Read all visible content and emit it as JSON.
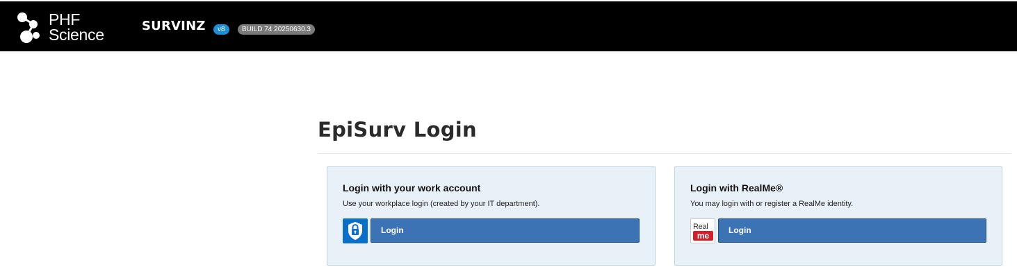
{
  "header": {
    "org_line1": "PHF",
    "org_line2": "Science",
    "logo_icon": "phf-molecule-logo-icon",
    "app_name": "SURVINZ",
    "version": "v8",
    "build": "BUILD 74 20250630.3"
  },
  "page": {
    "title": "EpiSurv Login"
  },
  "work_account": {
    "heading": "Login with your work account",
    "description": "Use your workplace login (created by your IT department).",
    "icon": "padlock-shield-icon",
    "button_label": "Login"
  },
  "realme": {
    "heading": "Login with RealMe®",
    "description": "You may login with or register a RealMe identity.",
    "icon_text_top": "Real",
    "icon_text_bottom": "me",
    "button_label": "Login"
  },
  "colors": {
    "header_bg": "#000000",
    "version_pill": "#1e8fd6",
    "build_pill": "#7a7a7a",
    "panel_bg": "#e8f1f8",
    "button_bg": "#3b73b5",
    "realme_red": "#d4202a"
  }
}
